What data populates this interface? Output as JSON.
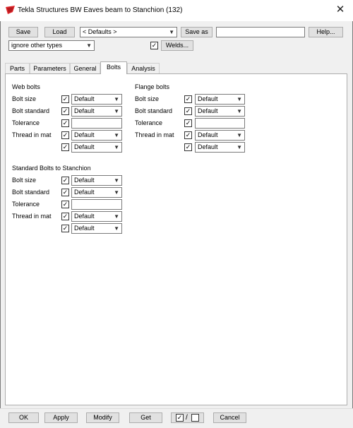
{
  "window": {
    "title": "Tekla Structures  BW Eaves beam to Stanchion (132)",
    "close_glyph": "✕",
    "app_icon": "tekla-logo-icon",
    "accent_color": "#e0262b"
  },
  "toolbar": {
    "save_label": "Save",
    "load_label": "Load",
    "defaults_value": "< Defaults >",
    "save_as_label": "Save as",
    "save_as_value": "",
    "help_label": "Help...",
    "filter_value": "ignore other types",
    "welds_label": "Welds...",
    "welds_checked": true
  },
  "tabs": [
    {
      "label": "Parts",
      "active": false
    },
    {
      "label": "Parameters",
      "active": false
    },
    {
      "label": "General",
      "active": false
    },
    {
      "label": "Bolts",
      "active": true
    },
    {
      "label": "Analysis",
      "active": false
    }
  ],
  "web_bolts": {
    "heading": "Web bolts",
    "bolt_size_label": "Bolt size",
    "bolt_size_value": "Default",
    "bolt_standard_label": "Bolt standard",
    "bolt_standard_value": "Default",
    "tolerance_label": "Tolerance",
    "tolerance_value": "",
    "thread_label": "Thread in mat",
    "thread_value_1": "Default",
    "thread_value_2": "Default"
  },
  "flange_bolts": {
    "heading": "Flange bolts",
    "bolt_size_label": "Bolt size",
    "bolt_size_value": "Default",
    "bolt_standard_label": "Bolt standard",
    "bolt_standard_value": "Default",
    "tolerance_label": "Tolerance",
    "tolerance_value": "",
    "thread_label": "Thread in mat",
    "thread_value_1": "Default",
    "thread_value_2": "Default"
  },
  "standard_bolts": {
    "heading": "Standard Bolts to Stanchion",
    "bolt_size_label": "Bolt size",
    "bolt_size_value": "Default",
    "bolt_standard_label": "Bolt standard",
    "bolt_standard_value": "Default",
    "tolerance_label": "Tolerance",
    "tolerance_value": "",
    "thread_label": "Thread in mat",
    "thread_value_1": "Default",
    "thread_value_2": "Default"
  },
  "footer": {
    "ok_label": "OK",
    "apply_label": "Apply",
    "modify_label": "Modify",
    "get_label": "Get",
    "toggle_separator": "/",
    "cancel_label": "Cancel"
  }
}
